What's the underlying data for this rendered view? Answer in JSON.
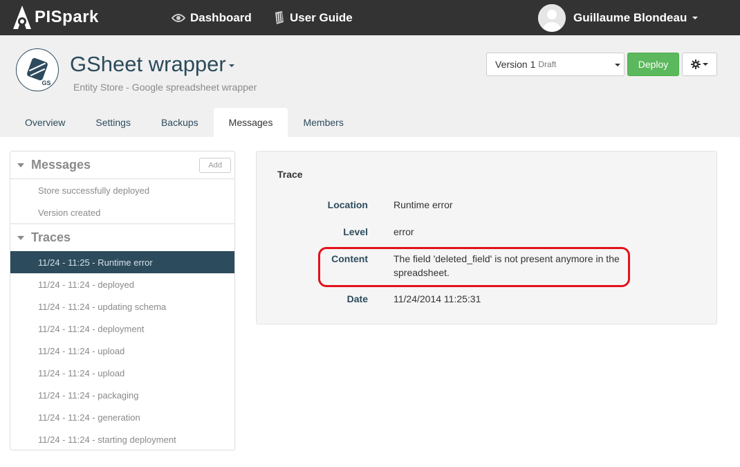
{
  "navbar": {
    "logo_text": "PISpark",
    "links": [
      {
        "label": "Dashboard",
        "icon": "eye-icon"
      },
      {
        "label": "User Guide",
        "icon": "book-icon"
      }
    ],
    "user_name": "Guillaume Blondeau"
  },
  "api": {
    "icon_badge": "GS",
    "title": "GSheet wrapper",
    "subtitle": "Entity Store - Google spreadsheet wrapper",
    "version_label": "Version 1",
    "version_status": "Draft",
    "deploy_label": "Deploy"
  },
  "tabs": [
    {
      "label": "Overview",
      "active": false
    },
    {
      "label": "Settings",
      "active": false
    },
    {
      "label": "Backups",
      "active": false
    },
    {
      "label": "Messages",
      "active": true
    },
    {
      "label": "Members",
      "active": false
    }
  ],
  "sidebar": {
    "messages_title": "Messages",
    "add_label": "Add",
    "messages": [
      "Store successfully deployed",
      "Version created"
    ],
    "traces_title": "Traces",
    "traces": [
      "11/24 - 11:25 - Runtime error",
      "11/24 - 11:24 - deployed",
      "11/24 - 11:24 - updating schema",
      "11/24 - 11:24 - deployment",
      "11/24 - 11:24 - upload",
      "11/24 - 11:24 - upload",
      "11/24 - 11:24 - packaging",
      "11/24 - 11:24 - generation",
      "11/24 - 11:24 - starting deployment"
    ],
    "selected_trace_index": 0
  },
  "detail": {
    "title": "Trace",
    "rows": [
      {
        "label": "Location",
        "value": "Runtime error"
      },
      {
        "label": "Level",
        "value": "error"
      },
      {
        "label": "Content",
        "value": "The field 'deleted_field' is not present anymore in the spreadsheet."
      },
      {
        "label": "Date",
        "value": "11/24/2014 11:25:31"
      }
    ],
    "highlighted_row": "Content"
  },
  "colors": {
    "navbar_bg": "#333333",
    "brand_dark": "#2c4b5c",
    "deploy_green": "#5cb85c",
    "highlight_red": "#e3101a"
  }
}
